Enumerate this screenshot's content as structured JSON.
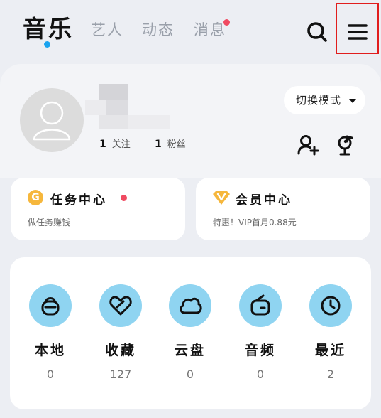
{
  "header": {
    "tabs": [
      {
        "label": "音乐",
        "active": true
      },
      {
        "label": "艺人",
        "active": false
      },
      {
        "label": "动态",
        "active": false
      },
      {
        "label": "消息",
        "active": false,
        "has_badge": true
      }
    ],
    "search_icon": "search-icon",
    "menu_icon": "menu-icon"
  },
  "profile": {
    "following_count": "1",
    "following_label": "关注",
    "followers_count": "1",
    "followers_label": "粉丝",
    "mode_button_label": "切换模式",
    "actions": [
      "add-friend-icon",
      "music-verify-icon"
    ]
  },
  "cards": {
    "tasks": {
      "title": "任务中心",
      "subtitle": "做任务赚钱",
      "icon": "G",
      "has_badge": true
    },
    "vip": {
      "title": "会员中心",
      "subtitle": "特惠！VIP首月0.88元",
      "icon": "vip-diamond-icon"
    }
  },
  "quick_access": [
    {
      "label": "本地",
      "count": "0",
      "icon": "local-icon"
    },
    {
      "label": "收藏",
      "count": "127",
      "icon": "favorite-icon"
    },
    {
      "label": "云盘",
      "count": "0",
      "icon": "cloud-icon"
    },
    {
      "label": "音频",
      "count": "0",
      "icon": "radio-icon"
    },
    {
      "label": "最近",
      "count": "2",
      "icon": "clock-icon"
    }
  ],
  "colors": {
    "accent_blue": "#1aa3ef",
    "badge_red": "#f04a61",
    "icon_circle": "#8fd4f1",
    "coin_gold": "#f6b73c",
    "highlight_border": "#e11d1d"
  }
}
